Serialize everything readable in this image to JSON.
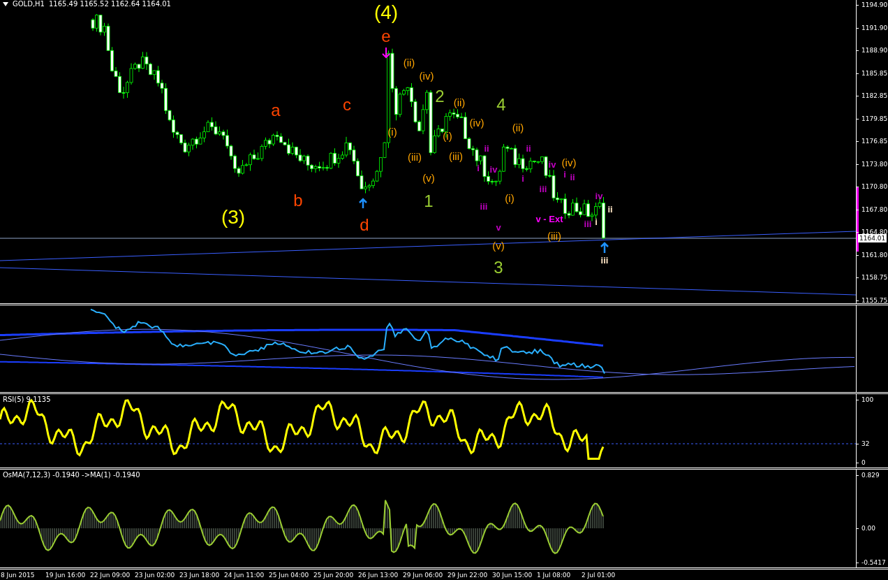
{
  "header": {
    "symbol": "GOLD,H1",
    "prices": [
      "1165.49",
      "1165.52",
      "1162.64",
      "1164.01"
    ]
  },
  "price_axis": {
    "ticks": [
      "1194.90",
      "1191.90",
      "1188.90",
      "1185.85",
      "1182.85",
      "1179.85",
      "1176.85",
      "1173.80",
      "1170.80",
      "1167.80",
      "1164.80",
      "1161.80",
      "1158.75",
      "1155.75"
    ],
    "current": "1164.01"
  },
  "wave_labels": [
    {
      "text": "(4)",
      "kind": "major",
      "color": "#ffff00"
    },
    {
      "text": "e",
      "kind": "primary",
      "color": "#ff4500"
    },
    {
      "text": "(ii)",
      "kind": "minor",
      "color": "#ffa500"
    },
    {
      "text": "(iv)",
      "kind": "minor",
      "color": "#ffa500"
    },
    {
      "text": "a",
      "kind": "primary",
      "color": "#ff4500"
    },
    {
      "text": "c",
      "kind": "primary",
      "color": "#ff4500"
    },
    {
      "text": "2",
      "kind": "primary",
      "color": "#9acd32"
    },
    {
      "text": "(ii)",
      "kind": "minor",
      "color": "#ffa500"
    },
    {
      "text": "4",
      "kind": "primary",
      "color": "#9acd32"
    },
    {
      "text": "(iv)",
      "kind": "minor",
      "color": "#ffa500"
    },
    {
      "text": "(ii)",
      "kind": "minor",
      "color": "#ffa500"
    },
    {
      "text": "(i)",
      "kind": "minor",
      "color": "#ffa500"
    },
    {
      "text": "(i)",
      "kind": "minor",
      "color": "#ffa500"
    },
    {
      "text": "(iii)",
      "kind": "minor",
      "color": "#ffa500"
    },
    {
      "text": "(iii)",
      "kind": "minor",
      "color": "#ffa500"
    },
    {
      "text": "ii",
      "kind": "sub",
      "color": "#c000c0"
    },
    {
      "text": "ii",
      "kind": "sub",
      "color": "#c000c0"
    },
    {
      "text": "(v)",
      "kind": "minor",
      "color": "#ffa500"
    },
    {
      "text": "i",
      "kind": "sub",
      "color": "#c000c0"
    },
    {
      "text": "iv",
      "kind": "sub",
      "color": "#c000c0"
    },
    {
      "text": "i",
      "kind": "sub",
      "color": "#c000c0"
    },
    {
      "text": "iv",
      "kind": "sub",
      "color": "#c000c0"
    },
    {
      "text": "(iv)",
      "kind": "minor",
      "color": "#ffa500"
    },
    {
      "text": "i",
      "kind": "sub",
      "color": "#c000c0"
    },
    {
      "text": "ii",
      "kind": "sub",
      "color": "#c000c0"
    },
    {
      "text": "b",
      "kind": "primary",
      "color": "#ff4500"
    },
    {
      "text": "1",
      "kind": "primary",
      "color": "#9acd32"
    },
    {
      "text": "iii",
      "kind": "sub",
      "color": "#c000c0"
    },
    {
      "text": "(i)",
      "kind": "minor",
      "color": "#ffa500"
    },
    {
      "text": "iii",
      "kind": "sub",
      "color": "#c000c0"
    },
    {
      "text": "iv",
      "kind": "sub",
      "color": "#c000c0"
    },
    {
      "text": "ii",
      "kind": "sub",
      "color": "#ffe4c4"
    },
    {
      "text": "(3)",
      "kind": "major",
      "color": "#ffff00"
    },
    {
      "text": "d",
      "kind": "primary",
      "color": "#ff4500"
    },
    {
      "text": "v",
      "kind": "sub",
      "color": "#c000c0"
    },
    {
      "text": "v - Ext",
      "kind": "sub",
      "color": "#ff00ff"
    },
    {
      "text": "iii",
      "kind": "sub",
      "color": "#c000c0"
    },
    {
      "text": "i",
      "kind": "sub",
      "color": "#ffe4c4"
    },
    {
      "text": "(iii)",
      "kind": "minor",
      "color": "#ffa500"
    },
    {
      "text": "(v)",
      "kind": "minor",
      "color": "#ffa500"
    },
    {
      "text": "iii",
      "kind": "sub",
      "color": "#ffe4c4"
    },
    {
      "text": "3",
      "kind": "primary",
      "color": "#9acd32"
    }
  ],
  "rsi": {
    "legend": "RSI(5) 9.1135",
    "ticks": [
      "100",
      "32",
      "0"
    ]
  },
  "osma": {
    "legend": "OsMA(7,12,3) -0.1940  ->MA(1) -0.1940",
    "ticks": [
      "0.829",
      "0.00",
      "-0.5417"
    ]
  },
  "time_axis": [
    "8 Jun 2015",
    "19 Jun 16:00",
    "22 Jun 09:00",
    "23 Jun 02:00",
    "23 Jun 18:00",
    "24 Jun 11:00",
    "25 Jun 04:00",
    "25 Jun 20:00",
    "26 Jun 13:00",
    "29 Jun 06:00",
    "29 Jun 22:00",
    "30 Jun 15:00",
    "1 Jul 08:00",
    "2 Jul 01:00"
  ]
}
